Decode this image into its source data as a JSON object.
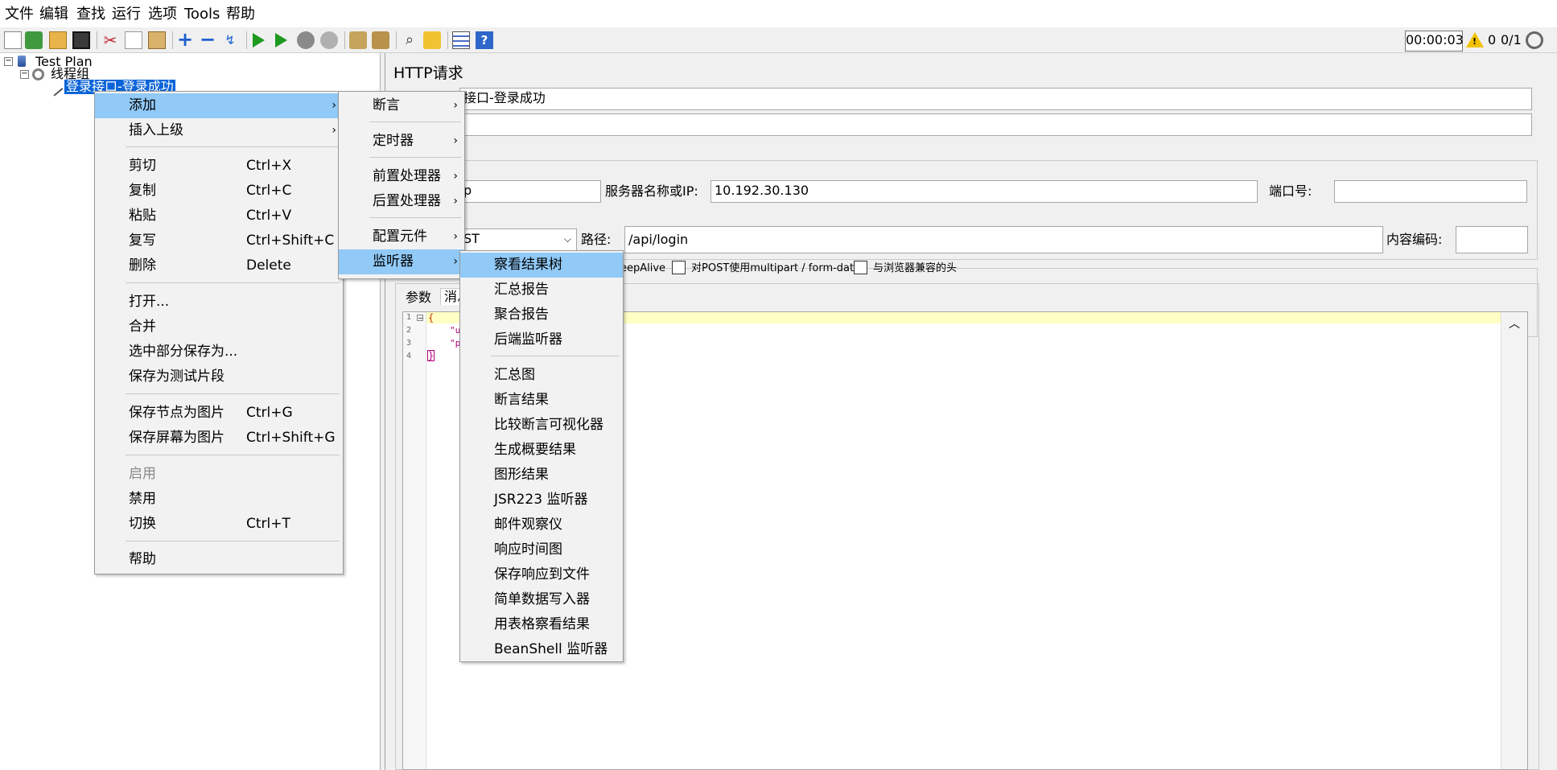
{
  "menubar": [
    "文件",
    "编辑",
    "查找",
    "运行",
    "选项",
    "Tools",
    "帮助"
  ],
  "toolbar": {
    "timer": "00:00:03",
    "warnings": "0",
    "threads": "0/1"
  },
  "tree": {
    "root": "Test Plan",
    "thread_group": "线程组",
    "selected": "登录接口-登录成功"
  },
  "panel": {
    "title": "HTTP请求",
    "name_value": "接口-登录成功",
    "server_label": "服务器名称或IP:",
    "server_value": "10.192.30.130",
    "port_label": "端口号:",
    "protocol_partial": "p",
    "method_partial": "ST",
    "path_label": "路径:",
    "path_value": "/api/login",
    "encoding_label": "内容编码:",
    "keepalive_partial": "eepAlive",
    "multipart_label": "对POST使用multipart / form-data",
    "browser_headers_label": "与浏览器兼容的头",
    "tab_params": "参数",
    "tab_body_partial": "消息"
  },
  "editor": {
    "line_numbers": [
      "1",
      "2",
      "3",
      "4"
    ],
    "line1": "{",
    "line2": "\"u",
    "line3": "\"p",
    "line4": "}"
  },
  "context_menu": [
    {
      "label": "添加",
      "submenu": true,
      "highlight": true
    },
    {
      "label": "插入上级",
      "submenu": true
    },
    {
      "label": "剪切",
      "shortcut": "Ctrl+X"
    },
    {
      "label": "复制",
      "shortcut": "Ctrl+C"
    },
    {
      "label": "粘贴",
      "shortcut": "Ctrl+V"
    },
    {
      "label": "复写",
      "shortcut": "Ctrl+Shift+C"
    },
    {
      "label": "删除",
      "shortcut": "Delete"
    },
    {
      "label": "打开..."
    },
    {
      "label": "合并"
    },
    {
      "label": "选中部分保存为..."
    },
    {
      "label": "保存为测试片段"
    },
    {
      "label": "保存节点为图片",
      "shortcut": "Ctrl+G"
    },
    {
      "label": "保存屏幕为图片",
      "shortcut": "Ctrl+Shift+G"
    },
    {
      "label": "启用",
      "disabled": true
    },
    {
      "label": "禁用"
    },
    {
      "label": "切换",
      "shortcut": "Ctrl+T"
    },
    {
      "label": "帮助"
    }
  ],
  "add_menu": [
    {
      "label": "断言"
    },
    {
      "label": "定时器"
    },
    {
      "label": "前置处理器"
    },
    {
      "label": "后置处理器"
    },
    {
      "label": "配置元件"
    },
    {
      "label": "监听器",
      "highlight": true
    }
  ],
  "listener_menu": [
    "察看结果树",
    "汇总报告",
    "聚合报告",
    "后端监听器",
    "汇总图",
    "断言结果",
    "比较断言可视化器",
    "生成概要结果",
    "图形结果",
    "JSR223 监听器",
    "邮件观察仪",
    "响应时间图",
    "保存响应到文件",
    "简单数据写入器",
    "用表格察看结果",
    "BeanShell 监听器"
  ],
  "colors": {
    "selection": "#0a64d8",
    "menu_highlight": "#91c9f7",
    "editor_current_line": "#ffffc4"
  }
}
